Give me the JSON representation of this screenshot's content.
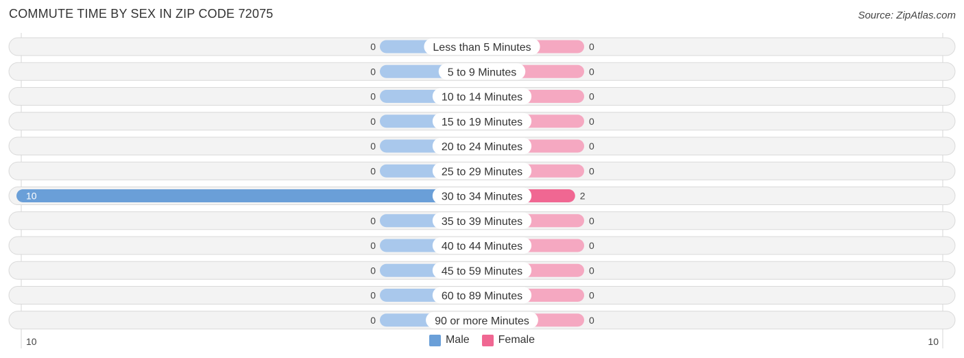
{
  "header": {
    "title": "COMMUTE TIME BY SEX IN ZIP CODE 72075",
    "source": "Source: ZipAtlas.com"
  },
  "colors": {
    "male": "#6a9fd8",
    "male_light": "#a9c8ec",
    "female": "#f06792",
    "female_light": "#f5a8c1"
  },
  "chart_data": {
    "type": "bar",
    "orientation": "horizontal-diverging",
    "title": "COMMUTE TIME BY SEX IN ZIP CODE 72075",
    "categories": [
      "Less than 5 Minutes",
      "5 to 9 Minutes",
      "10 to 14 Minutes",
      "15 to 19 Minutes",
      "20 to 24 Minutes",
      "25 to 29 Minutes",
      "30 to 34 Minutes",
      "35 to 39 Minutes",
      "40 to 44 Minutes",
      "45 to 59 Minutes",
      "60 to 89 Minutes",
      "90 or more Minutes"
    ],
    "series": [
      {
        "name": "Male",
        "values": [
          0,
          0,
          0,
          0,
          0,
          0,
          10,
          0,
          0,
          0,
          0,
          0
        ]
      },
      {
        "name": "Female",
        "values": [
          0,
          0,
          0,
          0,
          0,
          0,
          2,
          0,
          0,
          0,
          0,
          0
        ]
      }
    ],
    "axis": {
      "left_tick": "10",
      "right_tick": "10",
      "xlim": [
        -10,
        10
      ]
    },
    "legend": {
      "position": "bottom-center",
      "entries": [
        "Male",
        "Female"
      ]
    },
    "grid": false
  }
}
